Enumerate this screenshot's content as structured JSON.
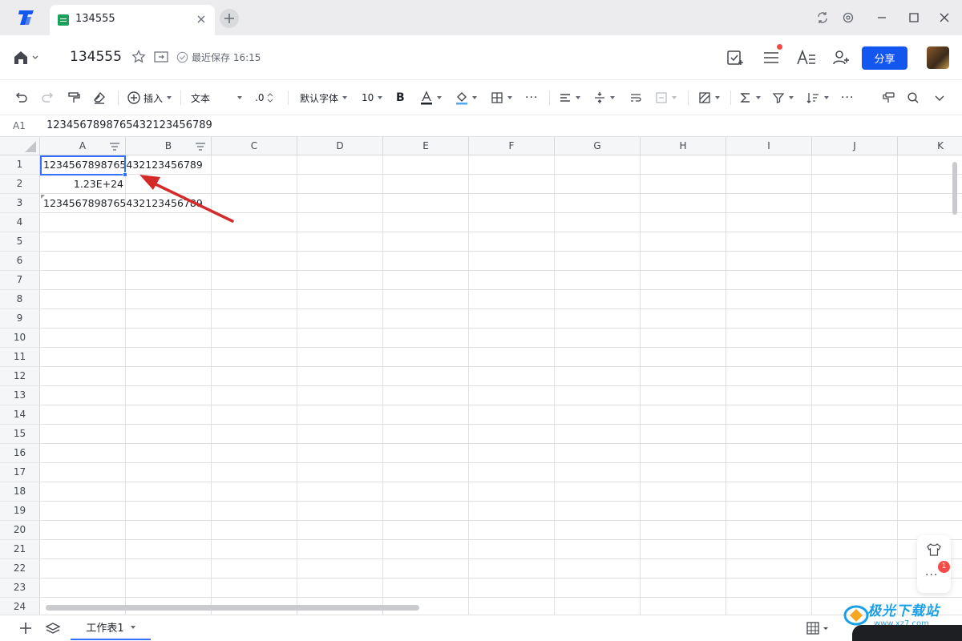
{
  "tabs": {
    "active_title": "134555"
  },
  "header": {
    "doc_title": "134555",
    "save_status": "最近保存 16:15",
    "share_label": "分享"
  },
  "toolbar": {
    "insert_label": "插入",
    "format_label": "文本",
    "decimal_label": ".0",
    "font_label": "默认字体",
    "size_label": "10",
    "bold_label": "B",
    "text_color": "#1f2329",
    "fill_color": "#4ea8f2"
  },
  "formula_bar": {
    "cell_ref": "A1",
    "value": "123456789876543212345678​9"
  },
  "grid": {
    "columns": [
      "A",
      "B",
      "C",
      "D",
      "E",
      "F",
      "G",
      "H",
      "I",
      "J",
      "K"
    ],
    "rows": [
      "1",
      "2",
      "3",
      "4",
      "5",
      "6",
      "7",
      "8",
      "9",
      "10",
      "11",
      "12",
      "13",
      "14",
      "15",
      "16",
      "17",
      "18",
      "19",
      "20",
      "21",
      "22",
      "23",
      "24"
    ],
    "cells": {
      "a1": "1234567898765432123456789",
      "a2": "1.23E+24",
      "a3": "1234567898765432123456789"
    }
  },
  "side": {
    "badge_count": "1",
    "more_label": "···"
  },
  "sheetbar": {
    "sheet_name": "工作表1"
  },
  "watermark": {
    "text": "极光下载站",
    "url": "www.xz7.com"
  },
  "colors": {
    "accent": "#1456f0",
    "selection": "#3370ff",
    "badge": "#f54a45",
    "arrow": "#d42a2a"
  }
}
